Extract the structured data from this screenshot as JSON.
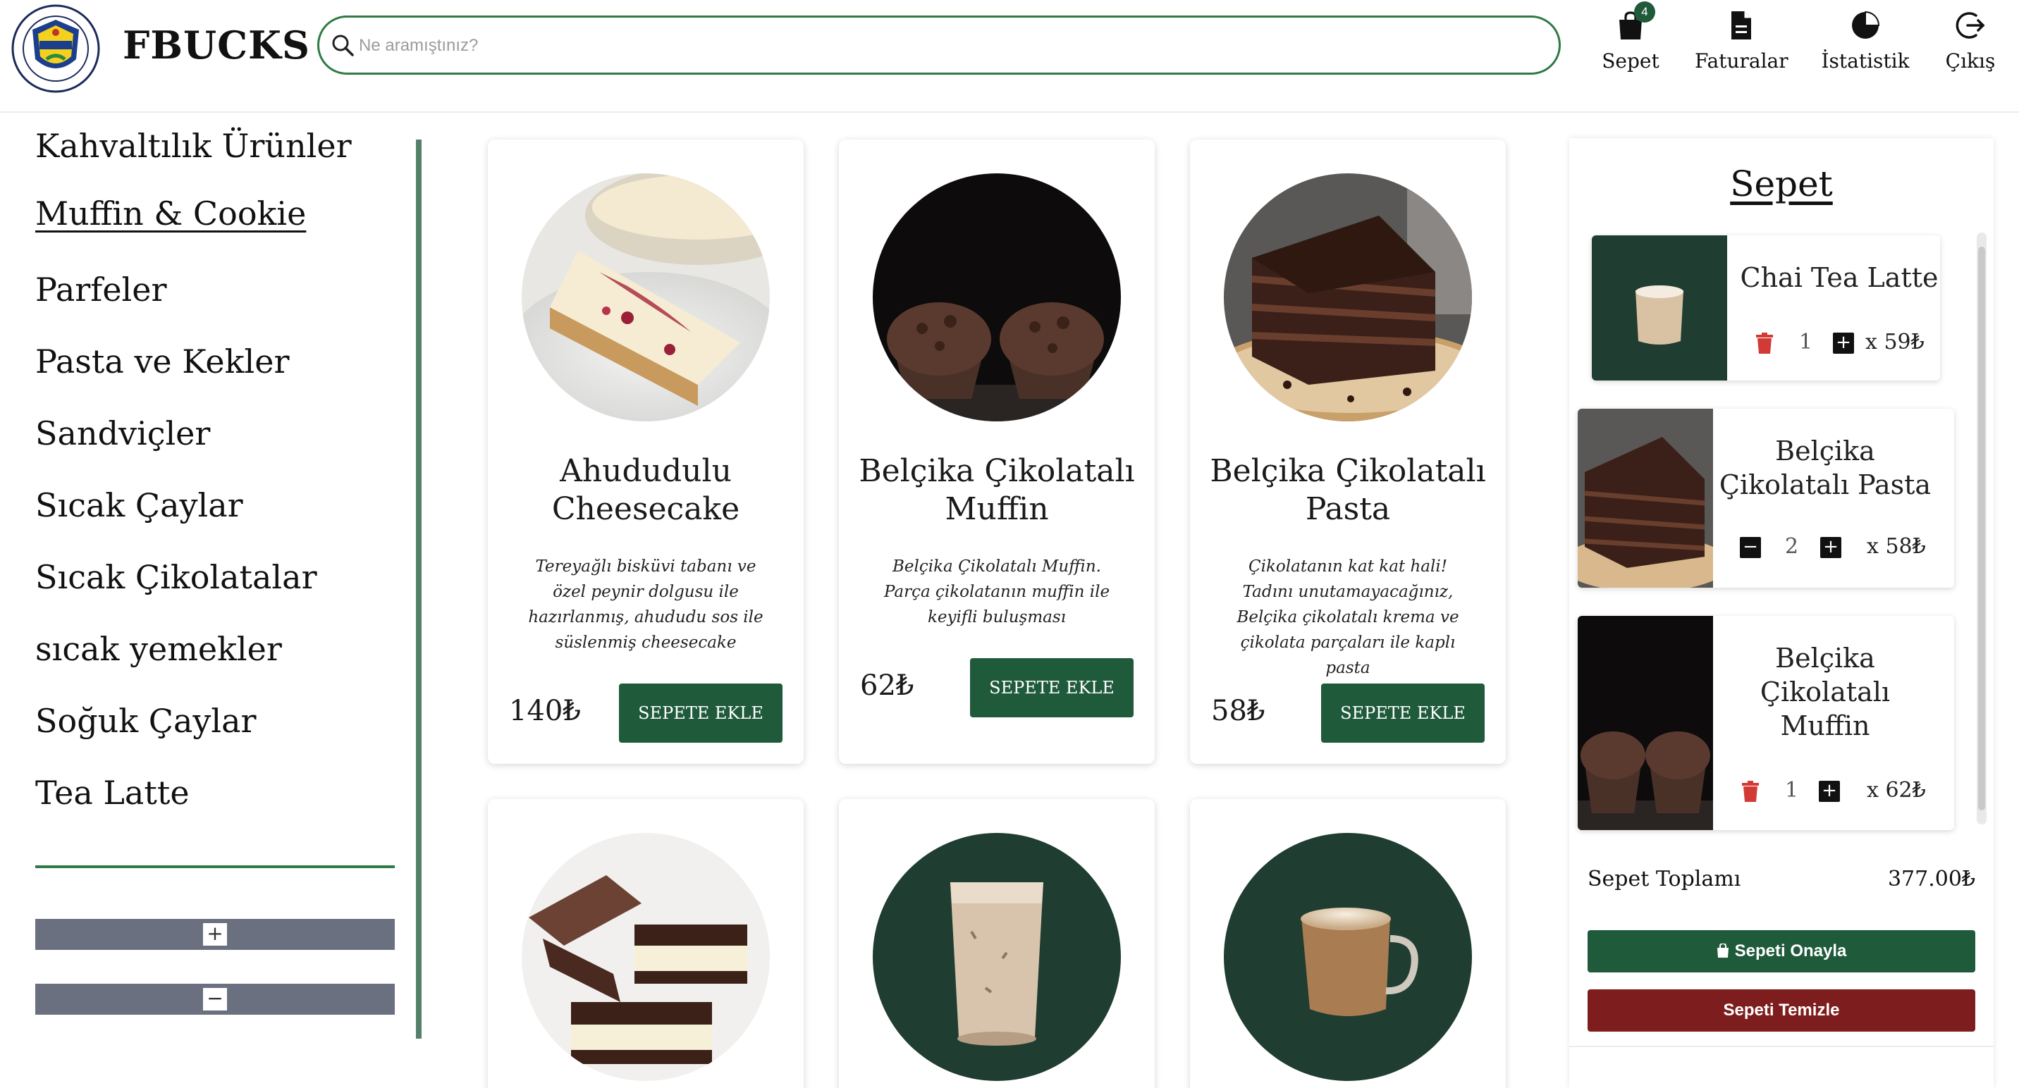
{
  "brand": {
    "name": "FBUCKS",
    "logo_alt": "Fenerbahçe Üniversitesi 2016"
  },
  "search": {
    "placeholder": "Ne aramıştınız?"
  },
  "nav": {
    "cart_label": "Sepet",
    "cart_badge": "4",
    "invoices_label": "Faturalar",
    "stats_label": "İstatistik",
    "logout_label": "Çıkış"
  },
  "sidebar": {
    "categories": [
      {
        "label": "Kahvaltılık Ürünler",
        "active": false
      },
      {
        "label": "Muffin & Cookie",
        "active": true
      },
      {
        "label": "Parfeler",
        "active": false
      },
      {
        "label": "Pasta ve Kekler",
        "active": false
      },
      {
        "label": "Sandviçler",
        "active": false
      },
      {
        "label": "Sıcak Çaylar",
        "active": false
      },
      {
        "label": "Sıcak Çikolatalar",
        "active": false
      },
      {
        "label": "sıcak yemekler",
        "active": false
      },
      {
        "label": "Soğuk Çaylar",
        "active": false
      },
      {
        "label": "Tea Latte",
        "active": false
      }
    ],
    "zoom_in": "+",
    "zoom_out": "−"
  },
  "products": [
    {
      "title": "Ahududulu Cheesecake",
      "description": "Tereyağlı bisküvi tabanı ve özel peynir dolgusu ile hazırlanmış, ahududu sos ile süslenmiş cheesecake",
      "price": "140₺",
      "button": "SEPETE EKLE"
    },
    {
      "title": "Belçika Çikolatalı Muffin",
      "description": "Belçika Çikolatalı Muffin. Parça çikolatanın muffin ile keyifli buluşması",
      "price": "62₺",
      "button": "SEPETE EKLE"
    },
    {
      "title": "Belçika Çikolatalı Pasta",
      "description": "Çikolatanın kat kat hali! Tadını unutamayacağınız, Belçika çikolatalı krema ve çikolata parçaları ile kaplı pasta",
      "price": "58₺",
      "button": "SEPETE EKLE"
    }
  ],
  "cart": {
    "title": "Sepet",
    "items": [
      {
        "name": "Chai Tea Latte",
        "qty": "1",
        "price": "x 59₺"
      },
      {
        "name": "Belçika Çikolatalı Pasta",
        "qty": "2",
        "price": "x 58₺"
      },
      {
        "name": "Belçika Çikolatalı Muffin",
        "qty": "1",
        "price": "x 62₺"
      }
    ],
    "total_label": "Sepet Toplamı",
    "total_value": "377.00₺",
    "confirm_label": "Sepeti Onayla",
    "clear_label": "Sepeti Temizle"
  },
  "colors": {
    "brand_green": "#1f5a3b",
    "accent_green": "#2f7a45",
    "danger_red": "#7d1d1d",
    "trash_red": "#d23a36"
  }
}
